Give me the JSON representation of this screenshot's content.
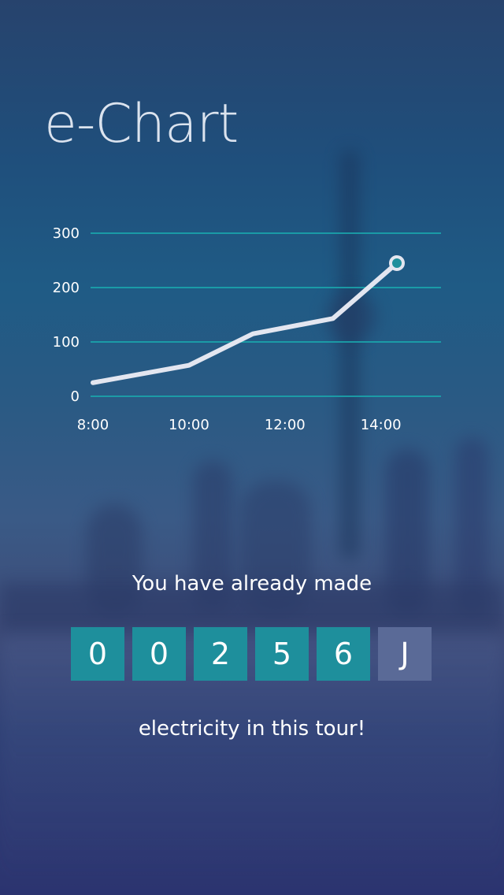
{
  "app": {
    "title": "e-Chart"
  },
  "chart_data": {
    "type": "line",
    "title": "",
    "xlabel": "",
    "ylabel": "",
    "x": [
      "8:00",
      "10:00",
      "11:20",
      "13:00",
      "14:20"
    ],
    "x_tick_labels": [
      "8:00",
      "10:00",
      "12:00",
      "14:00"
    ],
    "y_ticks": [
      0,
      100,
      200,
      300
    ],
    "ylim": [
      0,
      300
    ],
    "grid": true,
    "series": [
      {
        "values": [
          25,
          57,
          115,
          143,
          245
        ]
      }
    ],
    "colors": {
      "line": "#e3e6f0",
      "grid": "#1aa7ad",
      "marker_fill": "#1e8f9c"
    }
  },
  "summary": {
    "headline": "You have already made",
    "digits": [
      "0",
      "0",
      "2",
      "5",
      "6"
    ],
    "unit": "J",
    "footer": "electricity in this tour!"
  },
  "colors": {
    "digit_bg": "#1e8f9c",
    "unit_bg": "#5a6a97"
  }
}
